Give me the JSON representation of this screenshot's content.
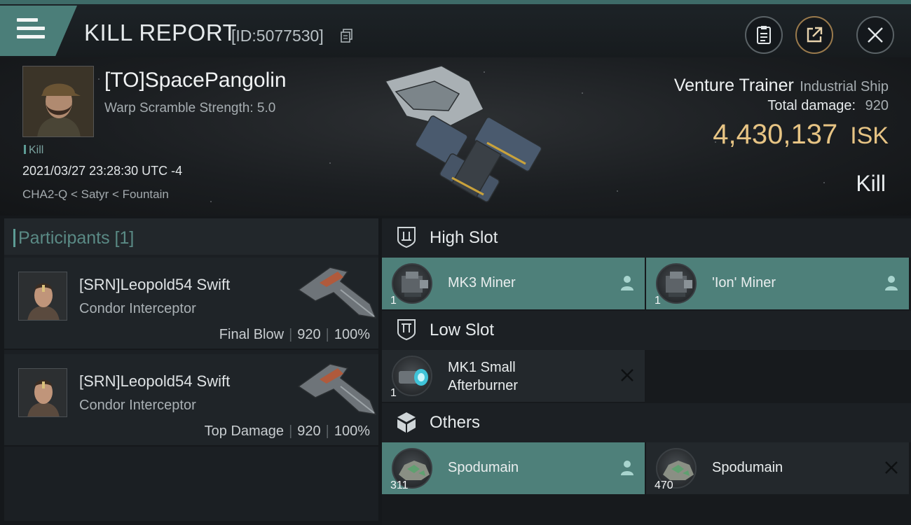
{
  "titlebar": {
    "title": "KILL REPORT",
    "report_id": "[ID:5077530]",
    "menu_icon": "hamburger-icon",
    "copy_icon": "copy-icon",
    "buttons": [
      {
        "name": "clipboard-icon"
      },
      {
        "name": "share-icon",
        "accent": "#9a7a4c"
      },
      {
        "name": "close-icon"
      }
    ]
  },
  "victim": {
    "name": "[TO]SpacePangolin",
    "warp_scramble": "Warp Scramble Strength: 5.0",
    "tag": "Kill",
    "datetime": "2021/03/27 23:28:30 UTC -4",
    "location": "CHA2-Q < Satyr < Fountain"
  },
  "ship": {
    "name": "Venture Trainer",
    "class": "Industrial Ship",
    "total_damage_label": "Total damage:",
    "total_damage": "920",
    "isk_value": "4,430,137",
    "isk_unit": "ISK",
    "result": "Kill"
  },
  "participants": {
    "title": "Participants [1]",
    "rows": [
      {
        "name": "[SRN]Leopold54 Swift",
        "ship": "Condor Interceptor",
        "role": "Final Blow",
        "damage": "920",
        "percent": "100%"
      },
      {
        "name": "[SRN]Leopold54 Swift",
        "ship": "Condor Interceptor",
        "role": "Top Damage",
        "damage": "920",
        "percent": "100%"
      }
    ]
  },
  "sections": {
    "high_slot": "High Slot",
    "low_slot": "Low Slot",
    "others": "Others"
  },
  "items": {
    "high": [
      {
        "name": "MK3 Miner",
        "qty": "1",
        "status": "dropped",
        "icon": "miner-icon"
      },
      {
        "name": "'Ion' Miner",
        "qty": "1",
        "status": "dropped",
        "icon": "miner-icon"
      }
    ],
    "low": [
      {
        "name_line1": "MK1 Small",
        "name_line2": "Afterburner",
        "qty": "1",
        "status": "destroyed",
        "icon": "afterburner-icon"
      }
    ],
    "others": [
      {
        "name": "Spodumain",
        "qty": "311",
        "status": "dropped",
        "icon": "ore-icon"
      },
      {
        "name": "Spodumain",
        "qty": "470",
        "status": "destroyed",
        "icon": "ore-icon"
      }
    ]
  },
  "colors": {
    "accent_teal": "#4e807a",
    "isk_gold": "#e7c484",
    "panel_dark": "#1b1f23"
  }
}
